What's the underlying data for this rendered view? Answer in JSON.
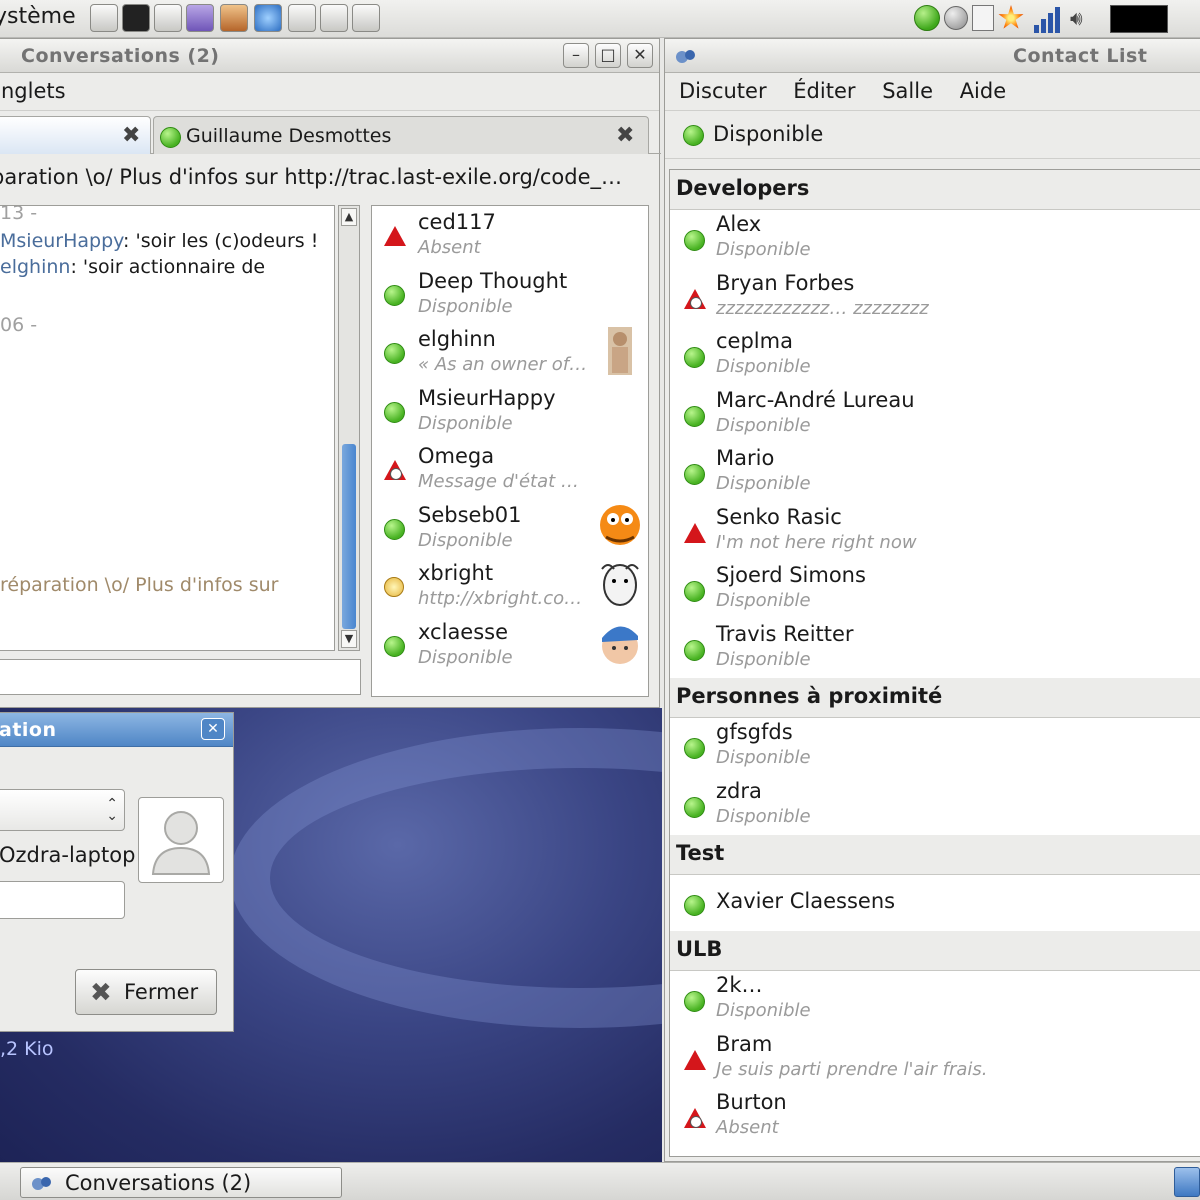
{
  "top_panel": {
    "menu_label": "ystème",
    "launchers": [
      "home-icon",
      "terminal-icon",
      "disk-icon",
      "pidgin-icon",
      "tools-icon",
      "browser-icon",
      "network-icon",
      "mail-icon",
      "text-editor-icon"
    ],
    "tray": [
      "empathy-status-icon",
      "disc-icon",
      "device-icon",
      "notification-star-icon",
      "signal-bars-icon",
      "volume-icon",
      "monitor-icon"
    ]
  },
  "conversations": {
    "title": "Conversations (2)",
    "menu_label": "nglets",
    "tabs": [
      {
        "label": ""
      },
      {
        "label": "Guillaume Desmottes"
      }
    ],
    "topic": "paration \\o/ Plus d'infos sur http://trac.last-exile.org/code_…",
    "log": {
      "time1": "13 -",
      "msg1_nick": "MsieurHappy",
      "msg1_text": ": 'soir les (c)odeurs !",
      "msg2_nick": "elghinn",
      "msg2_text": ": 'soir actionnaire de",
      "time2": "06 -",
      "faded": "réparation \\o/ Plus d'infos sur"
    },
    "members": [
      {
        "name": "ced117",
        "status": "Absent",
        "icon": "red"
      },
      {
        "name": "Deep Thought",
        "status": "Disponible",
        "icon": "green"
      },
      {
        "name": "elghinn",
        "status": "« As an owner of…",
        "icon": "green",
        "avatar": "statue"
      },
      {
        "name": "MsieurHappy",
        "status": "Disponible",
        "icon": "green"
      },
      {
        "name": "Omega",
        "status": "Message d'état …",
        "icon": "alarm"
      },
      {
        "name": "Sebseb01",
        "status": "Disponible",
        "icon": "green",
        "avatar": "garfield"
      },
      {
        "name": "xbright",
        "status": "http://xbright.co…",
        "icon": "note",
        "avatar": "gnu"
      },
      {
        "name": "xclaesse",
        "status": "Disponible",
        "icon": "green",
        "avatar": "face"
      }
    ]
  },
  "info_dialog": {
    "title": "ation",
    "host": "Ozdra-laptop",
    "close_label": "Fermer"
  },
  "desktop": {
    "size_text": ",2 Kio"
  },
  "contact_list": {
    "title": "Contact List",
    "menu": [
      "Discuter",
      "Éditer",
      "Salle",
      "Aide"
    ],
    "presence": "Disponible",
    "groups": [
      {
        "name": "Developers",
        "contacts": [
          {
            "name": "Alex",
            "status": "Disponible",
            "icon": "green"
          },
          {
            "name": "Bryan Forbes",
            "status": "zzzzzzzzzzzz… zzzzzzzz",
            "icon": "alarm"
          },
          {
            "name": "ceplma",
            "status": "Disponible",
            "icon": "green"
          },
          {
            "name": "Marc-André Lureau",
            "status": "Disponible",
            "icon": "green"
          },
          {
            "name": "Mario",
            "status": "Disponible",
            "icon": "green"
          },
          {
            "name": "Senko Rasic",
            "status": "I'm not here right now",
            "icon": "red"
          },
          {
            "name": "Sjoerd Simons",
            "status": "Disponible",
            "icon": "green"
          },
          {
            "name": "Travis Reitter",
            "status": "Disponible",
            "icon": "green"
          }
        ]
      },
      {
        "name": "Personnes à proximité",
        "contacts": [
          {
            "name": "gfsgfds",
            "status": "Disponible",
            "icon": "green"
          },
          {
            "name": "zdra",
            "status": "Disponible",
            "icon": "green"
          }
        ]
      },
      {
        "name": "Test",
        "contacts": [
          {
            "name": "Xavier Claessens",
            "status": "",
            "icon": "green"
          }
        ]
      },
      {
        "name": "ULB",
        "contacts": [
          {
            "name": "2k…",
            "status": "Disponible",
            "icon": "green"
          },
          {
            "name": "Bram",
            "status": "Je suis parti prendre l'air frais.",
            "icon": "red"
          },
          {
            "name": "Burton",
            "status": "Absent",
            "icon": "alarm"
          }
        ]
      }
    ]
  },
  "taskbar": {
    "button_label": "Conversations (2)"
  }
}
